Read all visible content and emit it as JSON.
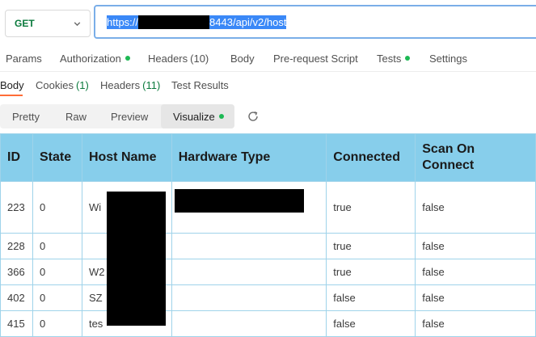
{
  "request": {
    "method": "GET",
    "url_start": "https://",
    "url_end": "8443/api/v2/host"
  },
  "request_tabs": [
    {
      "label": "Params",
      "count": "",
      "dot": false
    },
    {
      "label": "Authorization",
      "count": "",
      "dot": true
    },
    {
      "label": "Headers",
      "count": "(10)",
      "dot": false
    },
    {
      "label": "Body",
      "count": "",
      "dot": false
    },
    {
      "label": "Pre-request Script",
      "count": "",
      "dot": false
    },
    {
      "label": "Tests",
      "count": "",
      "dot": true
    },
    {
      "label": "Settings",
      "count": "",
      "dot": false
    }
  ],
  "response_tabs": [
    {
      "label": "Body",
      "count": ""
    },
    {
      "label": "Cookies",
      "count": "(1)"
    },
    {
      "label": "Headers",
      "count": "(11)"
    },
    {
      "label": "Test Results",
      "count": ""
    }
  ],
  "view_modes": [
    {
      "label": "Pretty"
    },
    {
      "label": "Raw"
    },
    {
      "label": "Preview"
    },
    {
      "label": "Visualize"
    }
  ],
  "table": {
    "headers": [
      "ID",
      "State",
      "Host Name",
      "Hardware Type",
      "Connected",
      "Scan On Connect"
    ],
    "rows": [
      [
        "223",
        "0",
        "Wi",
        "",
        "true",
        "false"
      ],
      [
        "228",
        "0",
        "",
        "",
        "true",
        "false"
      ],
      [
        "366",
        "0",
        "W2",
        "",
        "true",
        "false"
      ],
      [
        "402",
        "0",
        "SZ",
        "",
        "false",
        "false"
      ],
      [
        "415",
        "0",
        "tes",
        "",
        "false",
        "false"
      ]
    ]
  },
  "colors": {
    "accent_underline": "#ff6c37",
    "method_green": "#0b7a3d",
    "header_bg": "#87ceeb",
    "status_dot": "#1db954"
  }
}
